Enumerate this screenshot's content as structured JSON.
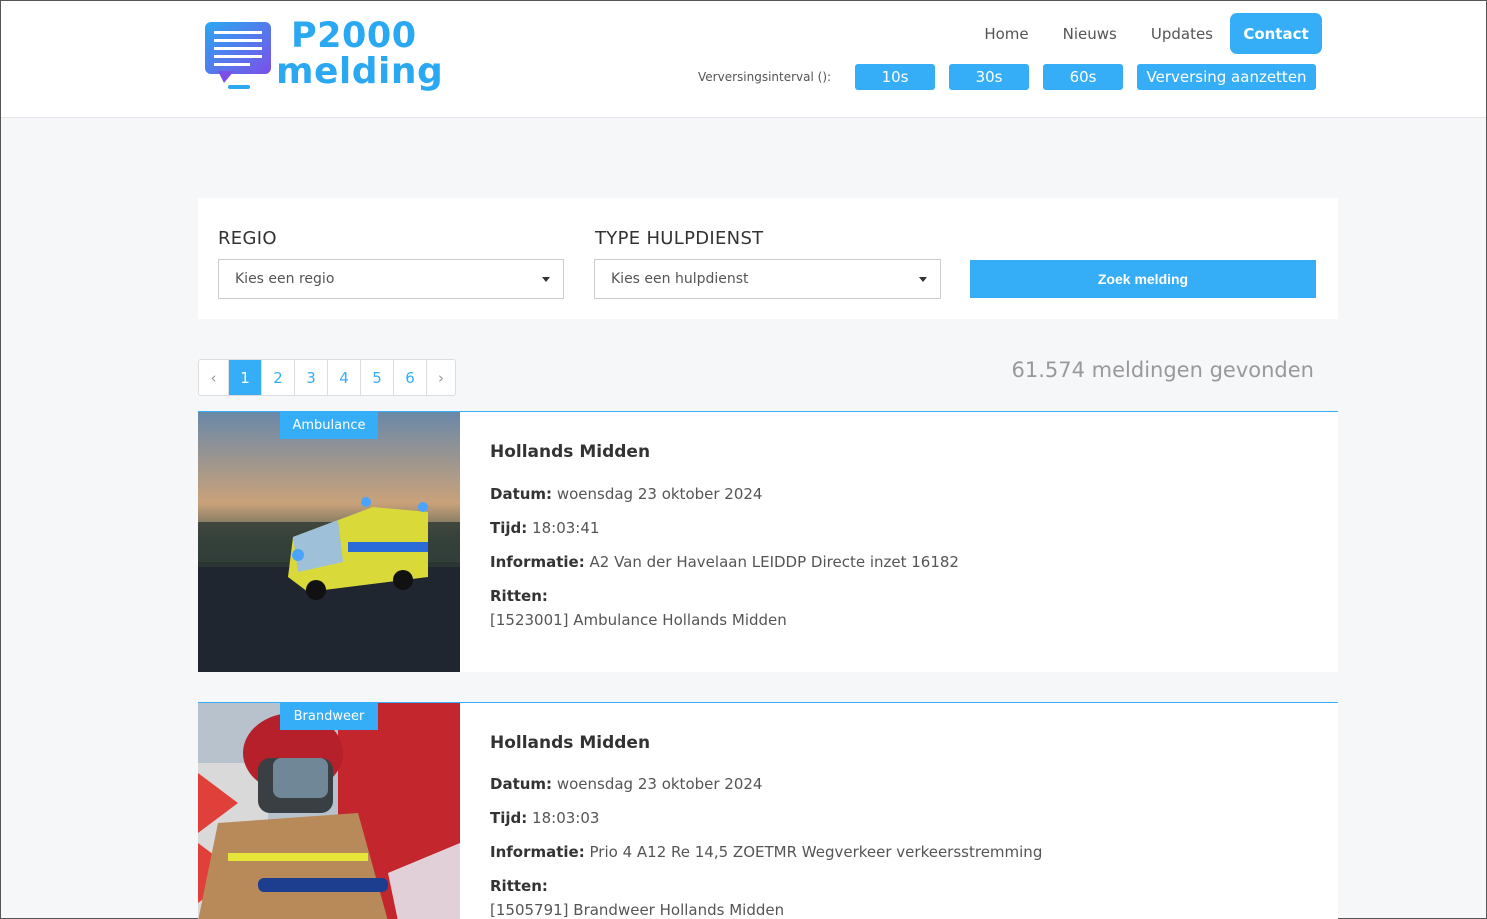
{
  "header": {
    "logo_line1": "P2000",
    "logo_line2": "melding",
    "nav": [
      "Home",
      "Nieuws",
      "Updates",
      "Contact"
    ],
    "refresh_label": "Verversingsinterval ():",
    "refresh_buttons": [
      "10s",
      "30s",
      "60s",
      "Verversing aanzetten"
    ]
  },
  "search": {
    "regio_label": "REGIO",
    "regio_placeholder": "Kies een regio",
    "type_label": "TYPE HULPDIENST",
    "type_placeholder": "Kies een hulpdienst",
    "button": "Zoek melding"
  },
  "pagination": {
    "prev": "‹",
    "pages": [
      "1",
      "2",
      "3",
      "4",
      "5",
      "6"
    ],
    "active": "1",
    "next": "›"
  },
  "result_count": "61.574 meldingen gevonden",
  "results": [
    {
      "badge": "Ambulance",
      "title": "Hollands Midden",
      "datum_label": "Datum:",
      "datum": "woensdag 23 oktober 2024",
      "tijd_label": "Tijd:",
      "tijd": "18:03:41",
      "info_label": "Informatie:",
      "info": "A2 Van der Havelaan LEIDDP Directe inzet 16182",
      "ritten_label": "Ritten:",
      "ritten": "[1523001] Ambulance Hollands Midden"
    },
    {
      "badge": "Brandweer",
      "title": "Hollands Midden",
      "datum_label": "Datum:",
      "datum": "woensdag 23 oktober 2024",
      "tijd_label": "Tijd:",
      "tijd": "18:03:03",
      "info_label": "Informatie:",
      "info": "Prio 4 A12 Re 14,5 ZOETMR Wegverkeer verkeersstremming",
      "ritten_label": "Ritten:",
      "ritten": "[1505791] Brandweer Hollands Midden"
    }
  ],
  "colors": {
    "accent": "#35aef7",
    "logo": "#2aa8f2",
    "background": "#f6f7f9"
  }
}
